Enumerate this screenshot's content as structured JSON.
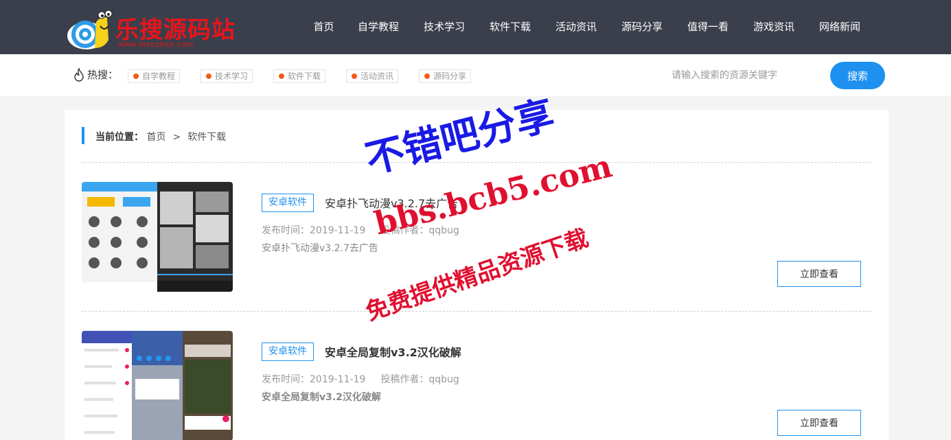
{
  "site": {
    "logo_text": "乐搜源码站",
    "logo_url": "www.lesozhan.com"
  },
  "nav": [
    {
      "label": "首页",
      "w": 63
    },
    {
      "label": "自学教程",
      "w": 96
    },
    {
      "label": "技术学习",
      "w": 96
    },
    {
      "label": "软件下载",
      "w": 96
    },
    {
      "label": "活动资讯",
      "w": 96
    },
    {
      "label": "源码分享",
      "w": 96
    },
    {
      "label": "值得一看",
      "w": 96
    },
    {
      "label": "游戏资讯",
      "w": 96
    },
    {
      "label": "网络新闻",
      "w": 96
    }
  ],
  "hot": {
    "label": "热搜：",
    "tags": [
      "自学教程",
      "技术学习",
      "软件下载",
      "活动资讯",
      "源码分享"
    ]
  },
  "search": {
    "placeholder": "请输入搜索的资源关键字",
    "button": "搜索"
  },
  "breadcrumb": {
    "label": "当前位置：",
    "home": "首页",
    "sep": ">",
    "current": "软件下载"
  },
  "items": [
    {
      "tag": "安卓软件",
      "title": "安卓扑飞动漫v3.2.7去广告",
      "date": "发布时间：2019-11-19",
      "author": "投稿作者：qqbug",
      "desc": "安卓扑飞动漫v3.2.7去广告",
      "button": "立即查看"
    },
    {
      "tag": "安卓软件",
      "title": "安卓全局复制v3.2汉化破解",
      "date": "发布时间：2019-11-19",
      "author": "投稿作者：qqbug",
      "desc": "安卓全局复制v3.2汉化破解",
      "button": "立即查看"
    }
  ],
  "watermark": {
    "line1": "不错吧分享",
    "line2": "bbs.bcb5.com",
    "line3": "免费提供精品资源下载"
  },
  "colors": {
    "header_bg": "#3b3f4b",
    "accent": "#1e91f0",
    "logo_red": "#e8141c",
    "hot_dot": "#f25b1c"
  }
}
